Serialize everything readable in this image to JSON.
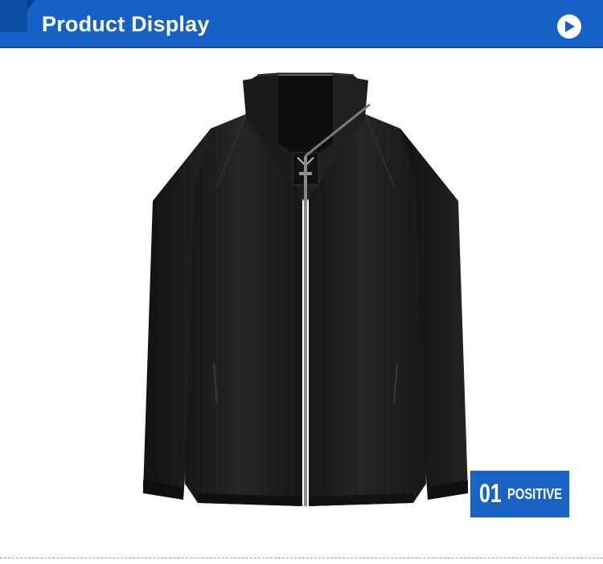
{
  "header": {
    "title": "Product Display",
    "band_color": "#1561c5",
    "accent_color": "#0b4ea3",
    "next_icon": "play-arrow-icon"
  },
  "product": {
    "image_subject": "black zip-up jacket",
    "color": "#1d1d1d",
    "zipper_color": "#8a8a8a"
  },
  "caption": {
    "number": "01",
    "label": "POSITIVE",
    "badge_color": "#1a63c2"
  }
}
